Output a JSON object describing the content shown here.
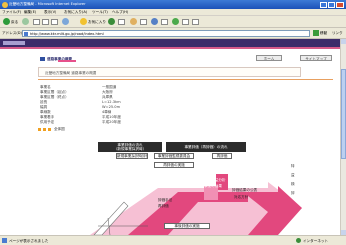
{
  "window": {
    "title": "近畿地方整備局 - Microsoft Internet Explorer",
    "controls": [
      "minimize",
      "maximize",
      "close"
    ]
  },
  "menu": [
    "ファイル(F)",
    "編集(E)",
    "表示(V)",
    "お気に入り(A)",
    "ツール(T)",
    "ヘルプ(H)"
  ],
  "toolbar": {
    "back": "戻る",
    "favorites": "お気に入り",
    "links": "リンク"
  },
  "address": {
    "label": "アドレス(D)",
    "url": "http://www.kkr.mlit.go.jp/road/index.html",
    "go": "移動"
  },
  "site": {
    "section_title": "道路事業の概要",
    "header_button_1": "ホーム",
    "header_button_2": "サイトマップ",
    "info_text": "近畿地方整備局 道路事業の概要",
    "details": [
      {
        "label": "事業名",
        "value": "一般国道"
      },
      {
        "label": "事業区間（起点）",
        "value": "大阪府"
      },
      {
        "label": "事業区間（終点）",
        "value": "兵庫県"
      },
      {
        "label": "延長",
        "value": "L=12.3km"
      },
      {
        "label": "幅員",
        "value": "W=25.0m"
      },
      {
        "label": "車線数",
        "value": "4車線"
      },
      {
        "label": "事業着手",
        "value": "平成10年度"
      },
      {
        "label": "供用予定",
        "value": "平成20年度"
      }
    ],
    "bullet_link": "全体図"
  },
  "diagram": {
    "left_header": "事業評価の流れ",
    "left_sub": "（新規事業採択時）",
    "right_header": "事業評価（再評価）の流れ",
    "box_left": "新規事業採択時評価",
    "box_right": "再評価",
    "label_1": "事業評価監視委員会",
    "label_2": "再評価の実施",
    "center_1": "費用便益分析",
    "center_2": "事業の効果",
    "right_label_1": "評価結果の公表",
    "right_label_2": "対応方針",
    "side_1": "特",
    "side_2": "益",
    "side_3": "検",
    "side_4": "評",
    "bottom_label": "事後評価の実施",
    "center_label_3": "評価手法",
    "center_label_4": "再評価"
  },
  "status": {
    "left": "ページが表示されました",
    "right": "インターネット"
  }
}
